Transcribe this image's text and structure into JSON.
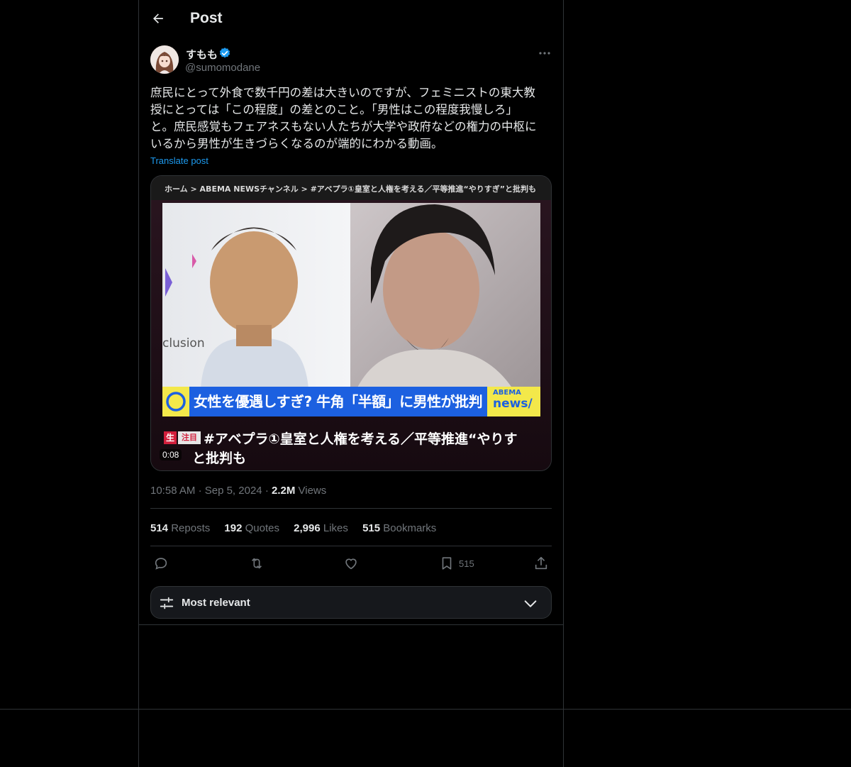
{
  "header": {
    "title": "Post"
  },
  "author": {
    "display_name": "すもも",
    "handle": "@sumomodane",
    "verified": true
  },
  "post": {
    "text": "庶民にとって外食で数千円の差は大きいのですが、フェミニストの東大教\n授にとっては「この程度」の差とのこと。「男性はこの程度我慢しろ」\nと。庶民感覚もフェアネスもない人たちが大学や政府などの権力の中枢に\nいるから男性が生きづらくなるのが端的にわかる動画。",
    "translate_label": "Translate post",
    "time": "10:58 AM",
    "date": "Sep 5, 2024",
    "views_count": "2.2M",
    "views_label": "Views"
  },
  "media": {
    "breadcrumb": "ホーム > ABEMA NEWSチャンネル > #アベプラ①皇室と人権を考える／平等推進“やりすぎ”と批判も",
    "caption": "女性を優遇しすぎ? 牛角「半額」に男性が批判",
    "logo_top": "ABEMA",
    "logo_bottom": "news/",
    "live_tag": "生",
    "hot_tag": "注目",
    "title_line1": "#アベプラ①皇室と人権を考える／平等推進“やりす",
    "title_line2": "と批判も",
    "timecode": "0:08",
    "side_text": "clusion"
  },
  "stats": {
    "reposts_count": "514",
    "reposts_label": "Reposts",
    "quotes_count": "192",
    "quotes_label": "Quotes",
    "likes_count": "2,996",
    "likes_label": "Likes",
    "bookmarks_count": "515",
    "bookmarks_label": "Bookmarks"
  },
  "actions": {
    "bookmark_count": "515"
  },
  "sort": {
    "label": "Most relevant"
  },
  "colors": {
    "accent": "#1d9bf0",
    "border": "#2f3336",
    "muted": "#71767b",
    "text": "#e7e9ea",
    "background": "#000000"
  },
  "icons": [
    "back-arrow-icon",
    "verified-badge-icon",
    "more-options-icon",
    "reply-icon",
    "repost-icon",
    "like-icon",
    "bookmark-icon",
    "share-icon",
    "sliders-icon",
    "chevron-down-icon"
  ]
}
